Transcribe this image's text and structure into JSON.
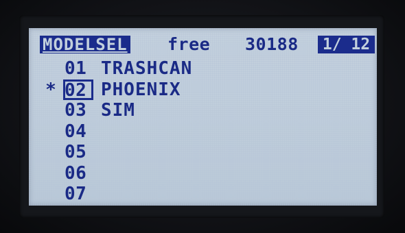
{
  "header": {
    "title": "MODELSEL",
    "free_label": "free",
    "free_value": "30188",
    "page_indicator": "1/ 12"
  },
  "models": [
    {
      "marker": "",
      "number": "01",
      "name": "TRASHCAN",
      "selected": false
    },
    {
      "marker": "*",
      "number": "02",
      "name": "PHOENIX",
      "selected": true
    },
    {
      "marker": "",
      "number": "03",
      "name": "SIM",
      "selected": false
    },
    {
      "marker": "",
      "number": "04",
      "name": "",
      "selected": false
    },
    {
      "marker": "",
      "number": "05",
      "name": "",
      "selected": false
    },
    {
      "marker": "",
      "number": "06",
      "name": "",
      "selected": false
    },
    {
      "marker": "",
      "number": "07",
      "name": "",
      "selected": false
    }
  ],
  "colors": {
    "lcd_background": "#c3d0dd",
    "lcd_ink": "#1a2a86",
    "bezel": "#111216"
  }
}
